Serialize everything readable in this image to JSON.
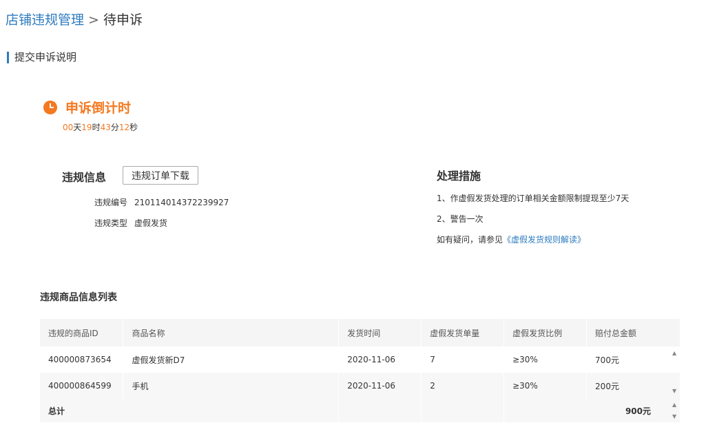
{
  "breadcrumb": {
    "parent": "店铺违规管理",
    "separator": ">",
    "current": "待申诉"
  },
  "section_title": "提交申诉说明",
  "countdown": {
    "title": "申诉倒计时",
    "days": "00",
    "days_unit": "天",
    "hours": "19",
    "hours_unit": "时",
    "minutes": "43",
    "minutes_unit": "分",
    "seconds": "12",
    "seconds_unit": "秒"
  },
  "violation_info": {
    "title": "违规信息",
    "download_button": "违规订单下载",
    "number_label": "违规编号",
    "number_value": "210114014372239927",
    "type_label": "违规类型",
    "type_value": "虚假发货"
  },
  "measures": {
    "title": "处理措施",
    "item1": "1、作虚假发货处理的订单相关金额限制提现至少7天",
    "item2": "2、警告一次",
    "help_text": "如有疑问，请参见",
    "help_link": "《虚假发货规则解读》"
  },
  "goods_list": {
    "title": "违规商品信息列表",
    "headers": [
      "违规的商品ID",
      "商品名称",
      "发货时间",
      "虚假发货单量",
      "虚假发货比例",
      "赔付总金额"
    ],
    "rows": [
      [
        "400000873654",
        "虚假发货新D7",
        "2020-11-06",
        "7",
        "≥30%",
        "700元"
      ],
      [
        "400000864599",
        "手机",
        "2020-11-06",
        "2",
        "≥30%",
        "200元"
      ]
    ],
    "total_label": "总计",
    "total_value": "900元"
  },
  "colors": {
    "accent": "#f47920",
    "link": "#2d7bbf"
  }
}
